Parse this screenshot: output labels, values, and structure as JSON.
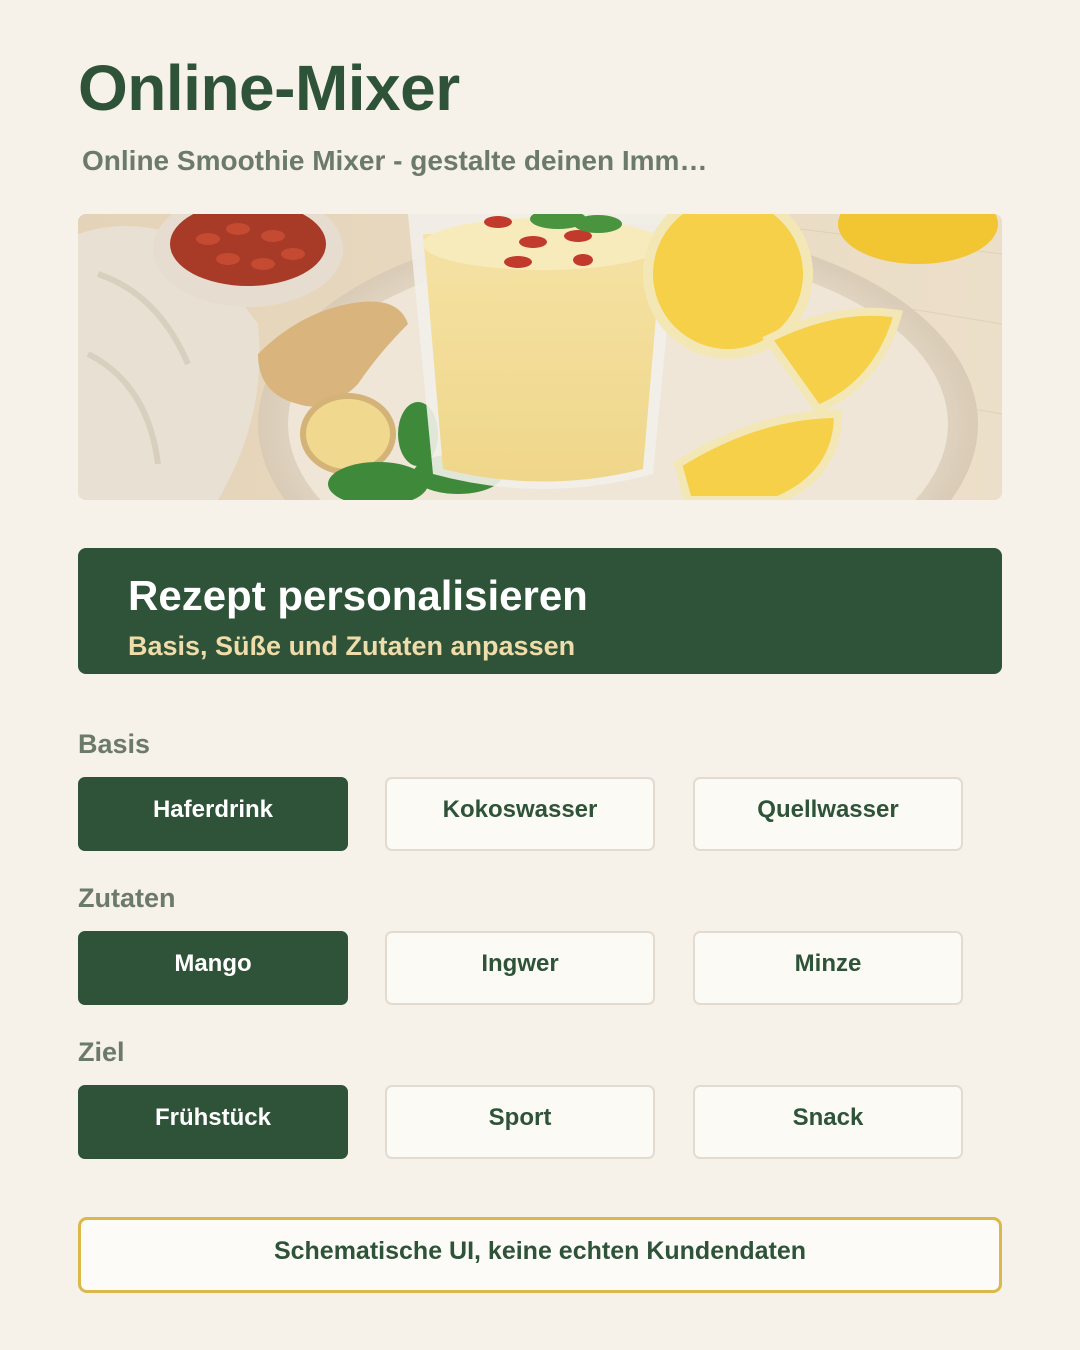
{
  "header": {
    "title": "Online-Mixer",
    "subtitle": "Online Smoothie Mixer - gestalte deinen Imm…"
  },
  "hero": {
    "description_icon": "smoothie-photo"
  },
  "banner": {
    "title": "Rezept personalisieren",
    "subtitle": "Basis, Süße und Zutaten anpassen"
  },
  "groups": [
    {
      "label": "Basis",
      "options": [
        {
          "label": "Haferdrink",
          "selected": true
        },
        {
          "label": "Kokoswasser",
          "selected": false
        },
        {
          "label": "Quellwasser",
          "selected": false
        }
      ]
    },
    {
      "label": "Zutaten",
      "options": [
        {
          "label": "Mango",
          "selected": true
        },
        {
          "label": "Ingwer",
          "selected": false
        },
        {
          "label": "Minze",
          "selected": false
        }
      ]
    },
    {
      "label": "Ziel",
      "options": [
        {
          "label": "Frühstück",
          "selected": true
        },
        {
          "label": "Sport",
          "selected": false
        },
        {
          "label": "Snack",
          "selected": false
        }
      ]
    }
  ],
  "notice": {
    "text": "Schematische UI, keine echten Kundendaten"
  },
  "colors": {
    "background": "#f6f1e9",
    "primary": "#2f5338",
    "accent_text": "#eedcaa",
    "notice_border": "#dbb84a"
  }
}
